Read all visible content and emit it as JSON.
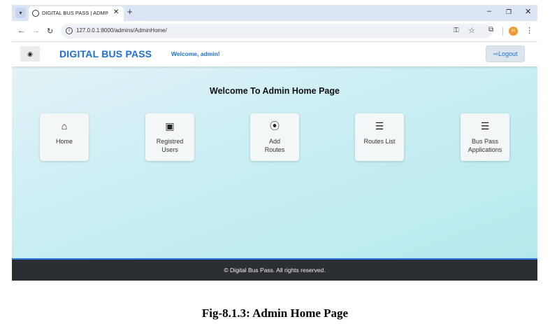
{
  "browser": {
    "tab_title": "DIGITAL BUS PASS | ADMIN HO",
    "tab_close": "✕",
    "new_tab": "+",
    "url": "127.0.0.1:8000/admins/AdminHome/",
    "profile_initial": "H",
    "window_controls": {
      "minimize": "–",
      "maximize": "❐",
      "close": "✕"
    }
  },
  "header": {
    "brand": "DIGITAL BUS PASS",
    "welcome": "Welcome, admin!",
    "logout_label": "Logout",
    "logout_icon": "sign-out-icon"
  },
  "main": {
    "title": "Welcome To Admin Home Page",
    "cards": [
      {
        "label": "Home",
        "icon": "home-icon",
        "glyph": "⌂"
      },
      {
        "label": "Registred\nUsers",
        "icon": "id-card-icon",
        "glyph": "▣"
      },
      {
        "label": "Add\nRoutes",
        "icon": "route-icon",
        "glyph": "⦿"
      },
      {
        "label": "Routes List",
        "icon": "list-icon",
        "glyph": "☰"
      },
      {
        "label": "Bus Pass\nApplications",
        "icon": "list-icon",
        "glyph": "☰"
      }
    ]
  },
  "footer": {
    "text": "© Digital Bus Pass. All rights reserved."
  },
  "caption": "Fig-8.1.3: Admin Home Page",
  "colors": {
    "brand_blue": "#1f6fd1",
    "footer_bg": "#2b2f33",
    "main_bg": "#c9eef3"
  }
}
